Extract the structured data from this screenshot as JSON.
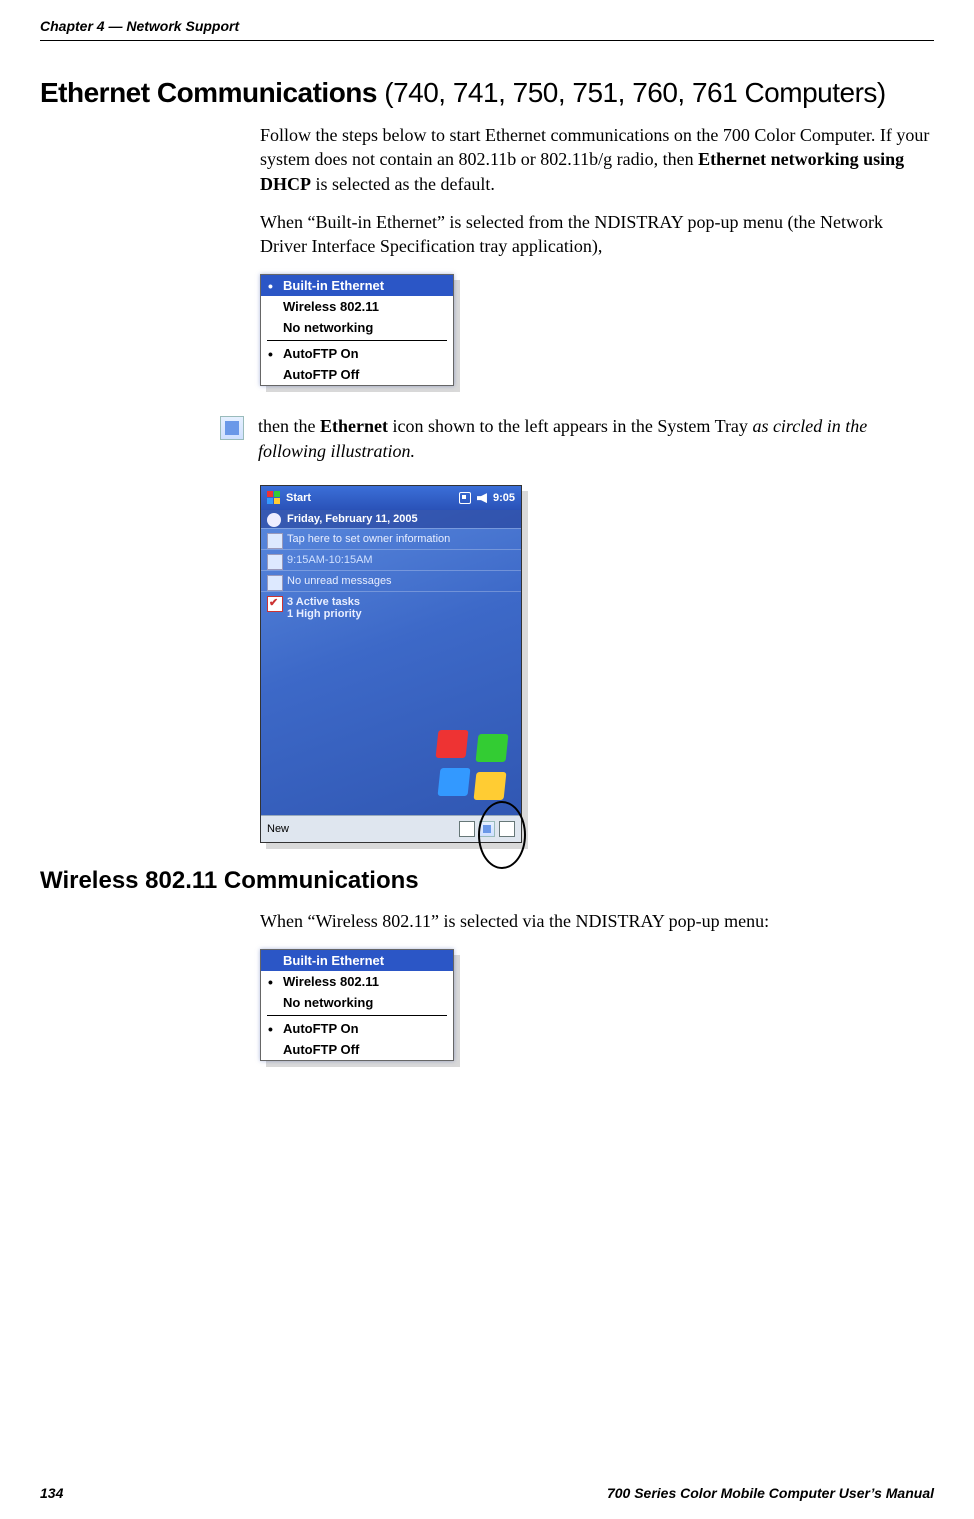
{
  "header": {
    "left": "Chapter 4  —  Network Support"
  },
  "h1": {
    "bold": "Ethernet Communications",
    "rest": " (740, 741, 750, 751, 760, 761 Computers)"
  },
  "p1a": "Follow the steps below to start Ethernet communications on the 700 Color Computer. If your system does not contain an 802.11b or 802.11b/g radio, then ",
  "p1b": "Ethernet networking using DHCP",
  "p1c": " is selected as the default.",
  "p2": "When “Built-in Ethernet” is selected from the NDISTRAY pop-up menu (the Network Driver Interface Specification tray application),",
  "menu1": {
    "builtIn": "Built-in Ethernet",
    "wireless": "Wireless 802.11",
    "noNet": "No networking",
    "autoOn": "AutoFTP On",
    "autoOff": "AutoFTP Off"
  },
  "iconLine": {
    "a": "then the ",
    "b": "Ethernet",
    "c": " icon shown to the left appears in the System Tray ",
    "d": "as circled in the following illustration."
  },
  "ppc": {
    "start": "Start",
    "time": "9:05",
    "date": "Friday, February 11, 2005",
    "owner": "Tap here to set owner information",
    "slot": "9:15AM-10:15AM",
    "msgs": "No unread messages",
    "tasks1": "3 Active tasks",
    "tasks2": "1 High priority",
    "new": "New"
  },
  "h2": "Wireless 802.11 Communications",
  "p3": "When “Wireless 802.11” is selected via the NDISTRAY pop-up menu:",
  "menu2": {
    "builtIn": "Built-in Ethernet",
    "wireless": "Wireless 802.11",
    "noNet": "No networking",
    "autoOn": "AutoFTP On",
    "autoOff": "AutoFTP Off"
  },
  "footer": {
    "page": "134",
    "title": "700 Series Color Mobile Computer User’s Manual"
  }
}
